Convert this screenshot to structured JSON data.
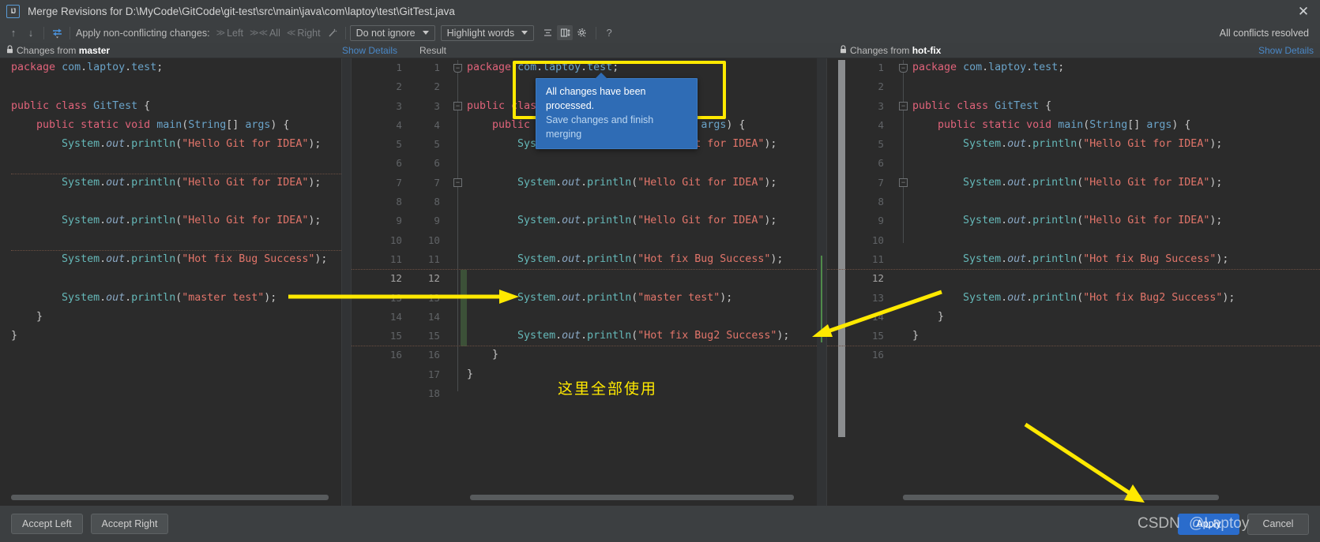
{
  "window": {
    "title": "Merge Revisions for D:\\MyCode\\GitCode\\git-test\\src\\main\\java\\com\\laptoy\\test\\GitTest.java",
    "logo": "IJ",
    "close_icon": "✕"
  },
  "toolbar": {
    "prev_icon": "↑",
    "next_icon": "↓",
    "magic_icon": "⤴",
    "apply_label": "Apply non-conflicting changes:",
    "left_label": "Left",
    "left_icon": "≫",
    "all_label": "All",
    "all_icon": "≫≪",
    "right_label": "Right",
    "right_icon": "≪",
    "wand_icon": "✦",
    "ignore_select": "Do not ignore",
    "highlight_select": "Highlight words",
    "collapse_icon": "≡",
    "columns_icon": "↕",
    "gear_icon": "⚙",
    "help_icon": "?",
    "status_right": "All conflicts resolved"
  },
  "headers": {
    "left_lock": "🔒",
    "left_prefix": "Changes from ",
    "left_branch": "master",
    "show_details_left": "Show Details",
    "result_label": "Result",
    "right_lock": "🔒",
    "right_prefix": "Changes from ",
    "right_branch": "hot-fix",
    "show_details_right": "Show Details"
  },
  "tooltip": {
    "line1": "All changes have been processed.",
    "line2": "Save changes and finish merging"
  },
  "annotation": {
    "chinese_note": "这里全部使用",
    "highlight_color": "#ffe900"
  },
  "left_pane": {
    "lines": [
      "package com.laptoy.test;",
      "",
      "public class GitTest {",
      "    public static void main(String[] args) {",
      "        System.out.println(\"Hello Git for IDEA\");",
      "",
      "        System.out.println(\"Hello Git for IDEA\");",
      "",
      "        System.out.println(\"Hello Git for IDEA\");",
      "",
      "        System.out.println(\"Hot fix Bug Success\");",
      "",
      "        System.out.println(\"master test\");",
      "    }",
      "}"
    ]
  },
  "center_pane": {
    "line_numbers_a": [
      "1",
      "2",
      "3",
      "4",
      "5",
      "6",
      "7",
      "8",
      "9",
      "10",
      "11",
      "12",
      "13",
      "14",
      "15",
      "16",
      "",
      ""
    ],
    "line_numbers_b": [
      "1",
      "2",
      "3",
      "4",
      "5",
      "6",
      "7",
      "8",
      "9",
      "10",
      "11",
      "12",
      "13",
      "14",
      "15",
      "16",
      "17",
      "18"
    ],
    "lines": [
      "package com.laptoy.test;",
      "",
      "public class GitTest {",
      "    public static void main(String[] args) {",
      "        System.out.println(\"Hello Git for IDEA\");",
      "",
      "        System.out.println(\"Hello Git for IDEA\");",
      "",
      "        System.out.println(\"Hello Git for IDEA\");",
      "",
      "        System.out.println(\"Hot fix Bug Success\");",
      "",
      "        System.out.println(\"master test\");",
      "",
      "        System.out.println(\"Hot fix Bug2 Success\");",
      "    }",
      "}",
      ""
    ]
  },
  "right_pane": {
    "line_numbers": [
      "1",
      "2",
      "3",
      "4",
      "5",
      "6",
      "7",
      "8",
      "9",
      "10",
      "11",
      "12",
      "13",
      "14",
      "15",
      "16"
    ],
    "lines": [
      "package com.laptoy.test;",
      "",
      "public class GitTest {",
      "    public static void main(String[] args) {",
      "        System.out.println(\"Hello Git for IDEA\");",
      "",
      "        System.out.println(\"Hello Git for IDEA\");",
      "",
      "        System.out.println(\"Hello Git for IDEA\");",
      "",
      "        System.out.println(\"Hot fix Bug Success\");",
      "",
      "        System.out.println(\"Hot fix Bug2 Success\");",
      "    }",
      "}",
      ""
    ]
  },
  "bottom": {
    "accept_left": "Accept Left",
    "accept_right": "Accept Right",
    "apply": "Apply",
    "cancel": "Cancel",
    "watermark_csdn": "CSDN",
    "watermark_user": "@Laptoy"
  }
}
